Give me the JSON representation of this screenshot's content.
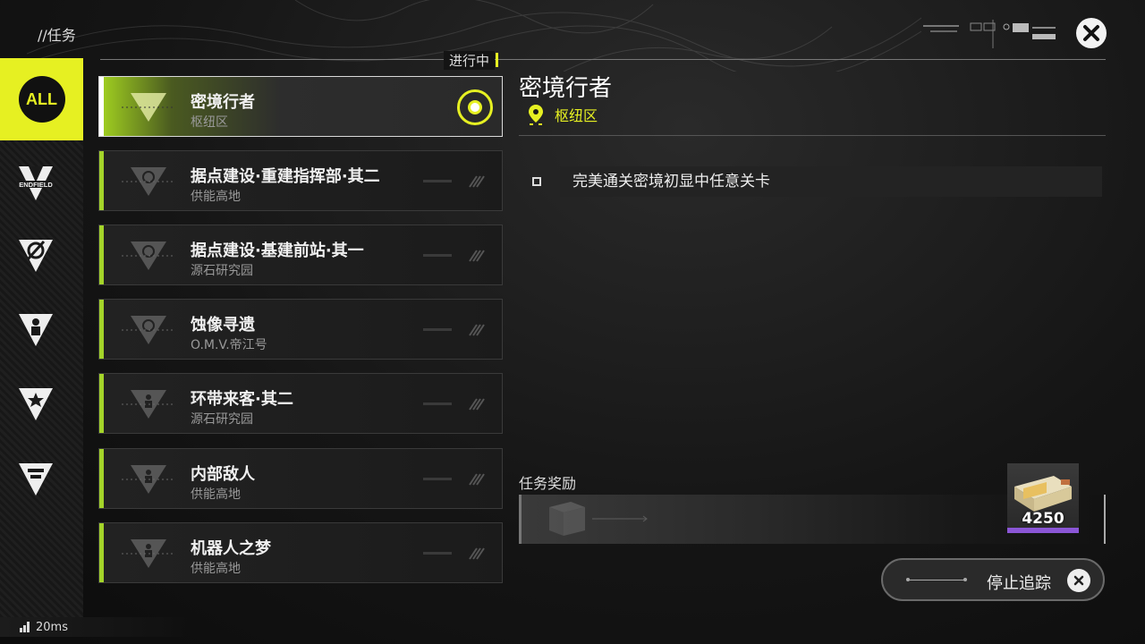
{
  "header": {
    "breadcrumb": "//任务"
  },
  "sidebar": {
    "all_label": "ALL",
    "items": [
      {
        "icon": "endfield-icon",
        "label": "ENDFIELD"
      },
      {
        "icon": "compass-triangle-icon"
      },
      {
        "icon": "person-triangle-icon"
      },
      {
        "icon": "star-triangle-icon"
      },
      {
        "icon": "building-triangle-icon"
      }
    ]
  },
  "list": {
    "status_tag": "进行中",
    "tasks": [
      {
        "name": "密境行者",
        "location": "枢纽区",
        "active": true
      },
      {
        "name": "据点建设·重建指挥部·其二",
        "location": "供能高地"
      },
      {
        "name": "据点建设·基建前站·其一",
        "location": "源石研究园"
      },
      {
        "name": "蚀像寻遗",
        "location": "O.M.V.帝江号"
      },
      {
        "name": "环带来客·其二",
        "location": "源石研究园"
      },
      {
        "name": "内部敌人",
        "location": "供能高地"
      },
      {
        "name": "机器人之梦",
        "location": "供能高地"
      }
    ]
  },
  "detail": {
    "title": "密境行者",
    "location": "枢纽区",
    "objective": "完美通关密境初显中任意关卡",
    "reward_label": "任务奖励",
    "reward_count": "4250",
    "stop_tracking_label": "停止追踪"
  },
  "status": {
    "ping": "20ms"
  },
  "colors": {
    "accent": "#e6f022",
    "task_bar": "#a4d42a",
    "reward_rarity": "#8b56d6"
  }
}
